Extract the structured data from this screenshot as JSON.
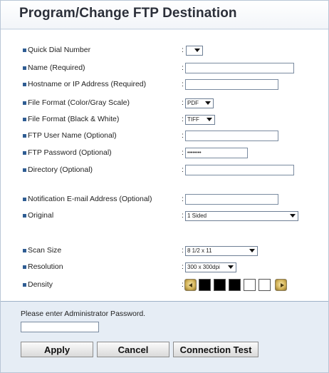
{
  "header": {
    "title": "Program/Change FTP Destination"
  },
  "fields": [
    {
      "label": "Quick Dial Number",
      "colon": ":"
    },
    {
      "label": "Name (Required)",
      "colon": ":"
    },
    {
      "label": "Hostname or IP Address (Required)",
      "colon": ":"
    },
    {
      "label": "File Format (Color/Gray Scale)",
      "colon": ":",
      "value": "PDF"
    },
    {
      "label": "File Format (Black & White)",
      "colon": ":",
      "value": "TIFF"
    },
    {
      "label": "FTP User Name (Optional)",
      "colon": ":"
    },
    {
      "label": "FTP Password (Optional)",
      "colon": ":",
      "value": "••••••••"
    },
    {
      "label": "Directory (Optional)",
      "colon": ":"
    },
    {
      "label": "Notification E-mail Address (Optional)",
      "colon": ":"
    },
    {
      "label": "Original",
      "colon": ":",
      "value": "1 Sided"
    },
    {
      "label": "Scan Size",
      "colon": ":",
      "value": "8 1/2 x 11"
    },
    {
      "label": "Resolution",
      "colon": ":",
      "value": "300 x 300dpi"
    },
    {
      "label": "Density",
      "colon": ":"
    }
  ],
  "density": {
    "icon_left": "decrease-arrow-icon",
    "icon_right": "increase-arrow-icon",
    "level_filled": 3,
    "level_total": 5,
    "filled_color": "#000000",
    "empty_color": "#ffffff"
  },
  "admin": {
    "prompt": "Please enter Administrator Password."
  },
  "buttons": {
    "apply": "Apply",
    "cancel": "Cancel",
    "connection_test": "Connection Test"
  },
  "colors": {
    "bullet": "#2f5d93",
    "background": "#e6edf5",
    "form_bg": "#ffffff"
  }
}
